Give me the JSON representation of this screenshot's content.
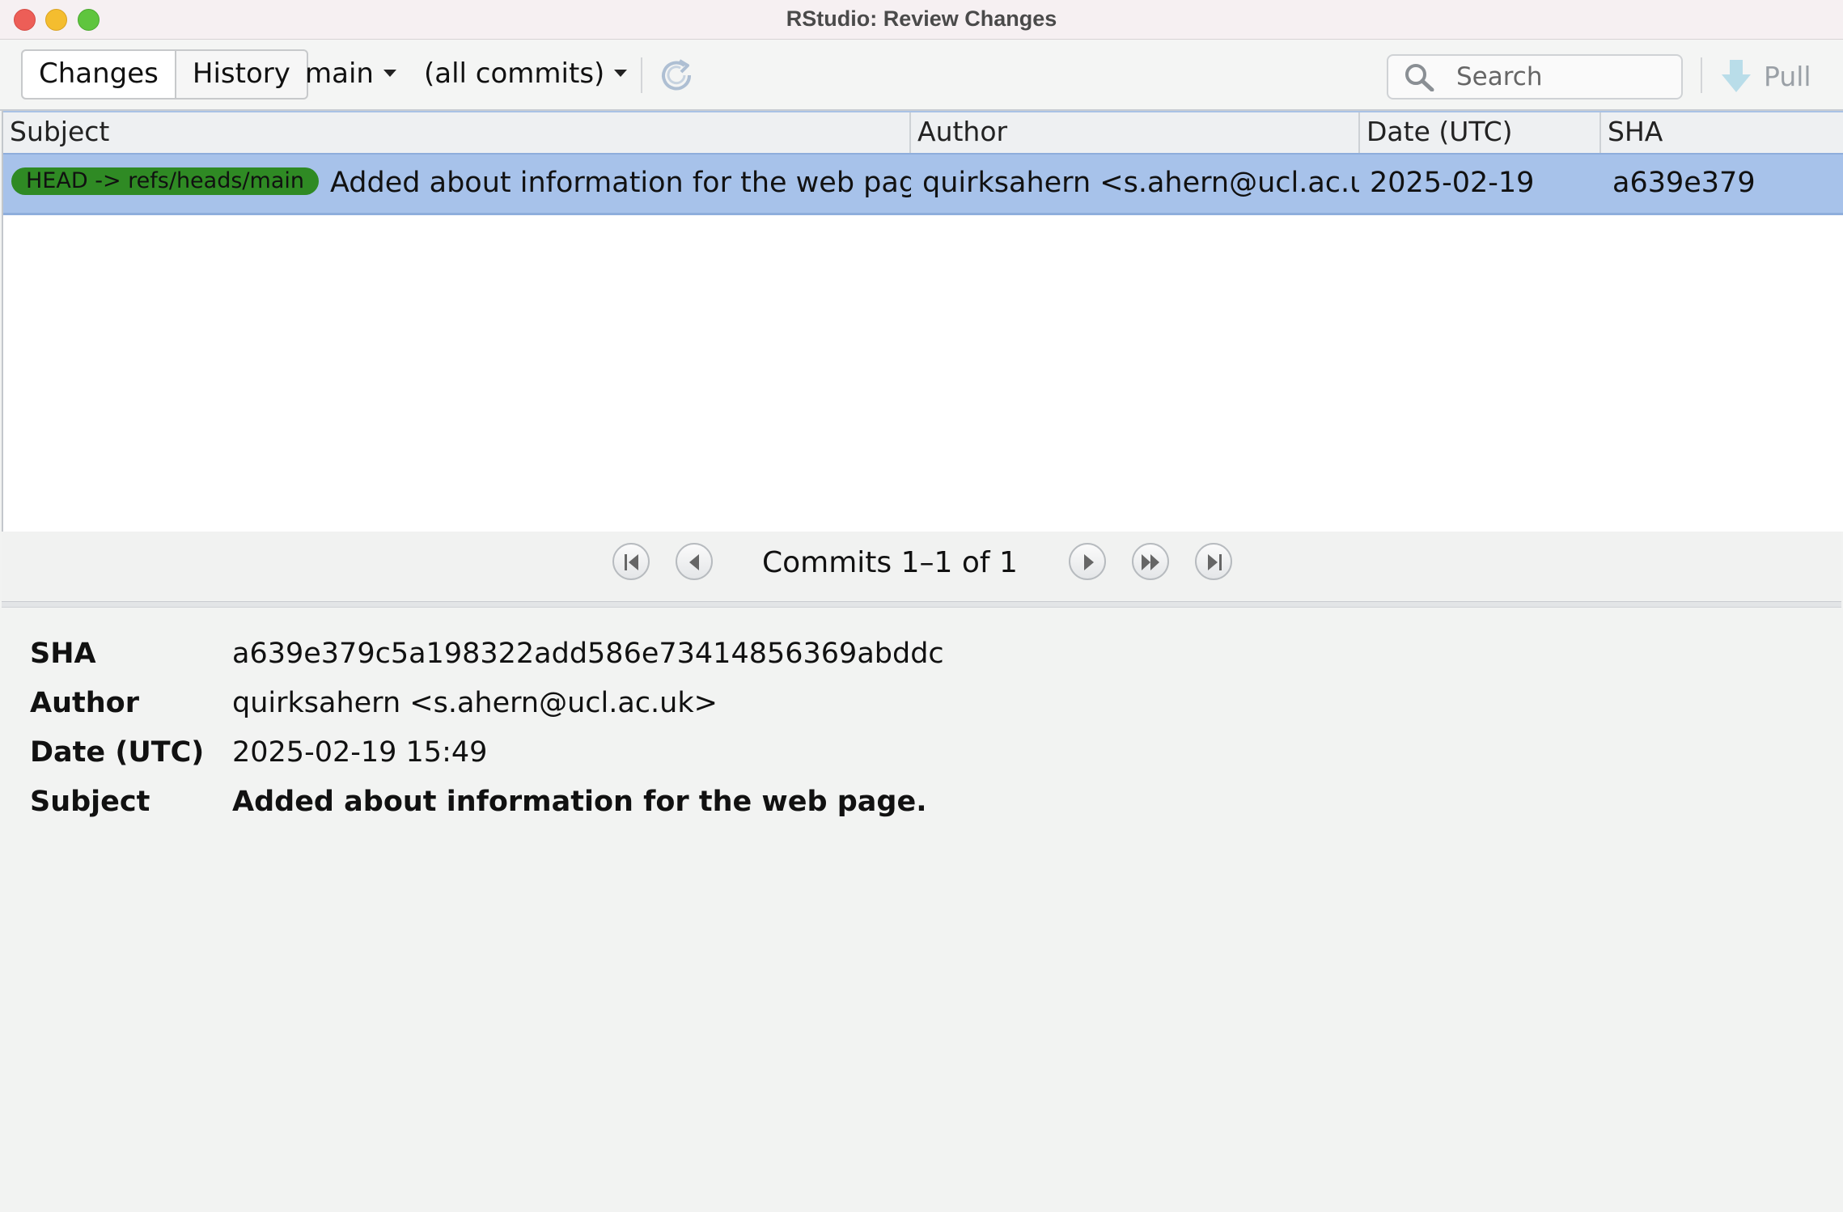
{
  "window": {
    "title": "RStudio: Review Changes"
  },
  "toolbar": {
    "tabs": [
      {
        "label": "Changes"
      },
      {
        "label": "History"
      }
    ],
    "branch": "main",
    "filter": "(all commits)",
    "search_placeholder": "Search",
    "pull_label": "Pull",
    "icons": [
      "refresh-icon",
      "search-icon",
      "pull-arrow-icon"
    ]
  },
  "table": {
    "columns": [
      "Subject",
      "Author",
      "Date (UTC)",
      "SHA"
    ],
    "rows": [
      {
        "ref": "HEAD -> refs/heads/main",
        "subject": "Added about information for the web page.",
        "author": "quirksahern <s.ahern@ucl.ac.uk>",
        "date": "2025-02-19",
        "sha": "a639e379"
      }
    ]
  },
  "pager": {
    "label": "Commits 1–1 of 1"
  },
  "details": {
    "sha_label": "SHA",
    "sha": "a639e379c5a198322add586e73414856369abddc",
    "author_label": "Author",
    "author": "quirksahern <s.ahern@ucl.ac.uk>",
    "date_label": "Date (UTC)",
    "date": "2025-02-19 15:49",
    "subject_label": "Subject",
    "subject": "Added about information for the web page."
  },
  "colors": {
    "selected_row": "#a7c2ea",
    "ref_badge": "#2f8a24"
  }
}
